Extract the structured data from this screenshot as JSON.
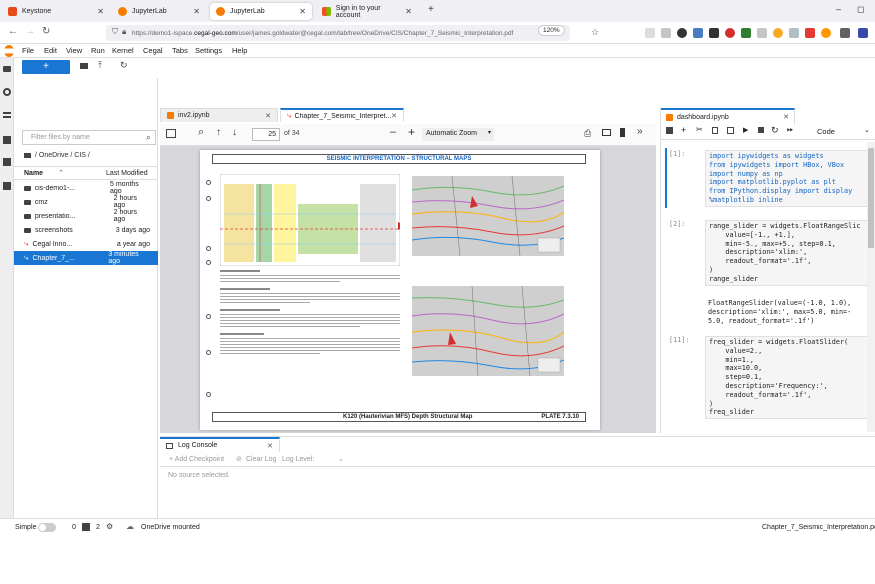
{
  "browser_tabs": [
    {
      "label": "Keystone",
      "color": "#e64a19"
    },
    {
      "label": "JupyterLab",
      "color": "#f57c00"
    },
    {
      "label": "JupyterLab",
      "color": "#f57c00"
    },
    {
      "label": "Sign in to your account",
      "color": "#1e88e5"
    }
  ],
  "new_tab": "+",
  "url": {
    "prefix": "https://demo1-ispace.",
    "domain": "cegal-geo.com",
    "path": "/user/james.goldwater@cegal.com/lab/tree/OneDrive/CIS/Chapter_7_Seismic_Interpretation.pdf",
    "zoom": "120%"
  },
  "menu": [
    "File",
    "Edit",
    "View",
    "Run",
    "Kernel",
    "Cegal",
    "Tabs",
    "Settings",
    "Help"
  ],
  "filebrowser": {
    "filter_placeholder": "Filter files by name",
    "path": "/ OneDrive / CIS /",
    "col_name": "Name",
    "col_modified": "Last Modified",
    "rows": [
      {
        "name": "cis-demo1-...",
        "time": "5 months ago",
        "icon": "folder-icon"
      },
      {
        "name": "cmz",
        "time": "2 hours ago",
        "icon": "folder-icon"
      },
      {
        "name": "presentatio...",
        "time": "2 hours ago",
        "icon": "folder-icon"
      },
      {
        "name": "screenshots",
        "time": "3 days ago",
        "icon": "folder-icon"
      },
      {
        "name": "Cegal Inno...",
        "time": "a year ago",
        "icon": "pdf-icon"
      },
      {
        "name": "Chapter_7_...",
        "time": "3 minutes ago",
        "icon": "pdf-icon"
      }
    ]
  },
  "doc_tabs": [
    {
      "label": "inv2.ipynb"
    },
    {
      "label": "Chapter_7_Seismic_Interpret..."
    }
  ],
  "pdf": {
    "page": "25",
    "of": "of 34",
    "zoom": "Automatic Zoom",
    "title": "SEISMIC INTERPRETATION – STRUCTURAL MAPS",
    "footer": "K120 (Hauterivian MFS) Depth Structural Map",
    "plate": "PLATE 7.3.10"
  },
  "notebook": {
    "tab": "dashboard.ipynb",
    "celltype": "Code",
    "cells": [
      {
        "prompt": "[1]:",
        "lines": [
          "import ipywidgets as widgets",
          "from ipywidgets import HBox, VBox",
          "import numpy as np",
          "import matplotlib.pyplot as plt",
          "from IPython.display import display",
          "%matplotlib inline"
        ]
      },
      {
        "prompt": "[2]:",
        "lines": [
          "range_slider = widgets.FloatRangeSlic",
          "    value=[-1., +1.],",
          "    min=-5., max=+5., step=0.1,",
          "    description='xlim:',",
          "    readout_format='.1f',",
          ")",
          "range_slider"
        ]
      },
      {
        "prompt": "",
        "lines": [
          "FloatRangeSlider(value=(-1.0, 1.0),",
          "description='xlim:', max=5.0, min=-",
          "5.0, readout_format='.1f')"
        ]
      },
      {
        "prompt": "[11]:",
        "lines": [
          "freq_slider = widgets.FloatSlider(",
          "    value=2.,",
          "    min=1.,",
          "    max=10.0,",
          "    step=0.1,",
          "    description='Frequency:',",
          "    readout_format='.1f',",
          ")",
          "freq_slider"
        ]
      }
    ]
  },
  "log": {
    "tab": "Log Console",
    "add_checkpoint": "+ Add Checkpoint",
    "clear_log": "Clear Log",
    "log_level": "Log Level:",
    "empty": "No source selected."
  },
  "status": {
    "mode": "Simple",
    "n1": "0",
    "n2": "2",
    "onedrive": "OneDrive mounted",
    "right": "Chapter_7_Seismic_Interpretation.pdf"
  }
}
